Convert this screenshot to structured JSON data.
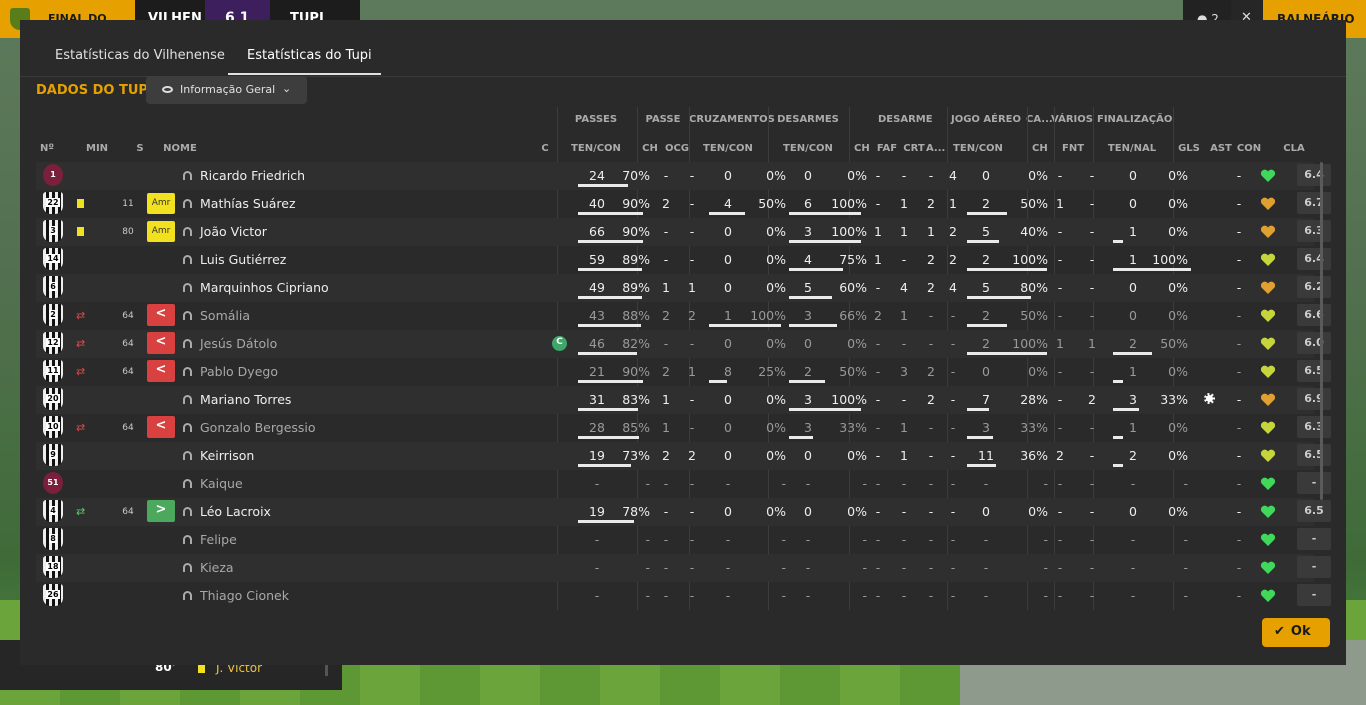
{
  "topbar": {
    "status": "FINAL DO JOGO",
    "home": "VILHEN",
    "away": "TUPI",
    "score": "6   1",
    "people_count": "2",
    "close_glyph": "✕",
    "balneario": "BALNEÁRIO"
  },
  "bg_events": {
    "minute": "80'",
    "player": "J. Victor"
  },
  "tabs": [
    {
      "label": "Estatísticas do Vilhenense",
      "active": false
    },
    {
      "label": "Estatísticas do Tupi",
      "active": true
    }
  ],
  "section_title": "DADOS DO TUPI",
  "dropdown": {
    "label": "Informação Geral"
  },
  "groups": [
    "PASSES",
    "PASSE",
    "CRUZAMENTOS",
    "DESARMES",
    "DESARME",
    "JOGO AÉREO",
    "CA...",
    "VÁRIOS",
    "FINALIZAÇÃO"
  ],
  "headers": [
    "Nº",
    "MIN",
    "S",
    "NOME",
    "C",
    "TEN/CON",
    "CH",
    "OCG",
    "TEN/CON",
    "TEN/CON",
    "CH",
    "FAF",
    "CRT",
    "A...",
    "TEN/CON",
    "CH",
    "FNT",
    "TEN/NAL",
    "GLS",
    "AST",
    "CON",
    "CLA"
  ],
  "players": [
    {
      "n": "1",
      "gk": true,
      "card": false,
      "min": "",
      "badge": "",
      "name": "Ricardo Friedrich",
      "dim": false,
      "cap": false,
      "pt": "24",
      "pp": "70%",
      "pch": "-",
      "pocg": "-",
      "ct": "0",
      "cp": "0%",
      "dt": "0",
      "dp": "0%",
      "dch": "-",
      "dfaf": "-",
      "dcrt": "-",
      "da": "4",
      "at": "0",
      "ap": "0%",
      "cach": "-",
      "fnt": "-",
      "ft": "0",
      "fp": "0%",
      "gls": "",
      "ast": "-",
      "con": "green",
      "cla": "6.4"
    },
    {
      "n": "22",
      "gk": false,
      "card": true,
      "min": "11",
      "badge": "Amr",
      "name": "Mathías Suárez",
      "dim": false,
      "cap": false,
      "pt": "40",
      "pp": "90%",
      "pch": "2",
      "pocg": "-",
      "ct": "4",
      "cp": "50%",
      "dt": "6",
      "dp": "100%",
      "dch": "-",
      "dfaf": "1",
      "dcrt": "2",
      "da": "1",
      "at": "2",
      "ap": "50%",
      "cach": "1",
      "fnt": "-",
      "ft": "0",
      "fp": "0%",
      "gls": "",
      "ast": "-",
      "con": "orange",
      "cla": "6.7"
    },
    {
      "n": "3",
      "gk": false,
      "card": true,
      "min": "80",
      "badge": "Amr",
      "name": "João Victor",
      "dim": false,
      "cap": false,
      "pt": "66",
      "pp": "90%",
      "pch": "-",
      "pocg": "-",
      "ct": "0",
      "cp": "0%",
      "dt": "3",
      "dp": "100%",
      "dch": "1",
      "dfaf": "1",
      "dcrt": "1",
      "da": "2",
      "at": "5",
      "ap": "40%",
      "cach": "-",
      "fnt": "-",
      "ft": "1",
      "fp": "0%",
      "gls": "",
      "ast": "-",
      "con": "orange",
      "cla": "6.3"
    },
    {
      "n": "14",
      "gk": false,
      "card": false,
      "min": "",
      "badge": "",
      "name": "Luis Gutiérrez",
      "dim": false,
      "cap": false,
      "pt": "59",
      "pp": "89%",
      "pch": "-",
      "pocg": "-",
      "ct": "0",
      "cp": "0%",
      "dt": "4",
      "dp": "75%",
      "dch": "1",
      "dfaf": "-",
      "dcrt": "2",
      "da": "2",
      "at": "2",
      "ap": "100%",
      "cach": "-",
      "fnt": "-",
      "ft": "1",
      "fp": "100%",
      "gls": "",
      "ast": "-",
      "con": "yellow",
      "cla": "6.4"
    },
    {
      "n": "6",
      "gk": false,
      "card": false,
      "min": "",
      "badge": "",
      "name": "Marquinhos Cipriano",
      "dim": false,
      "cap": false,
      "pt": "49",
      "pp": "89%",
      "pch": "1",
      "pocg": "1",
      "ct": "0",
      "cp": "0%",
      "dt": "5",
      "dp": "60%",
      "dch": "-",
      "dfaf": "4",
      "dcrt": "2",
      "da": "4",
      "at": "5",
      "ap": "80%",
      "cach": "-",
      "fnt": "-",
      "ft": "0",
      "fp": "0%",
      "gls": "",
      "ast": "-",
      "con": "orange",
      "cla": "6.2"
    },
    {
      "n": "2",
      "gk": false,
      "card": false,
      "min": "64",
      "badge": "out",
      "name": "Somália",
      "dim": true,
      "cap": false,
      "pt": "43",
      "pp": "88%",
      "pch": "2",
      "pocg": "2",
      "ct": "1",
      "cp": "100%",
      "dt": "3",
      "dp": "66%",
      "dch": "2",
      "dfaf": "1",
      "dcrt": "-",
      "da": "-",
      "at": "2",
      "ap": "50%",
      "cach": "-",
      "fnt": "-",
      "ft": "0",
      "fp": "0%",
      "gls": "",
      "ast": "-",
      "con": "yellow",
      "cla": "6.6"
    },
    {
      "n": "12",
      "gk": false,
      "card": false,
      "min": "64",
      "badge": "out",
      "name": "Jesús Dátolo",
      "dim": true,
      "cap": true,
      "pt": "46",
      "pp": "82%",
      "pch": "-",
      "pocg": "-",
      "ct": "0",
      "cp": "0%",
      "dt": "0",
      "dp": "0%",
      "dch": "-",
      "dfaf": "-",
      "dcrt": "-",
      "da": "-",
      "at": "2",
      "ap": "100%",
      "cach": "1",
      "fnt": "1",
      "ft": "2",
      "fp": "50%",
      "gls": "",
      "ast": "-",
      "con": "yellow",
      "cla": "6.0"
    },
    {
      "n": "11",
      "gk": false,
      "card": false,
      "min": "64",
      "badge": "out",
      "name": "Pablo Dyego",
      "dim": true,
      "cap": false,
      "pt": "21",
      "pp": "90%",
      "pch": "2",
      "pocg": "1",
      "ct": "8",
      "cp": "25%",
      "dt": "2",
      "dp": "50%",
      "dch": "-",
      "dfaf": "3",
      "dcrt": "2",
      "da": "-",
      "at": "0",
      "ap": "0%",
      "cach": "-",
      "fnt": "-",
      "ft": "1",
      "fp": "0%",
      "gls": "",
      "ast": "-",
      "con": "yellow",
      "cla": "6.5"
    },
    {
      "n": "20",
      "gk": false,
      "card": false,
      "min": "",
      "badge": "",
      "name": "Mariano Torres",
      "dim": false,
      "cap": false,
      "pt": "31",
      "pp": "83%",
      "pch": "1",
      "pocg": "-",
      "ct": "0",
      "cp": "0%",
      "dt": "3",
      "dp": "100%",
      "dch": "-",
      "dfaf": "-",
      "dcrt": "2",
      "da": "-",
      "at": "7",
      "ap": "28%",
      "cach": "-",
      "fnt": "2",
      "ft": "3",
      "fp": "33%",
      "gls": "ball",
      "ast": "-",
      "con": "orange",
      "cla": "6.9"
    },
    {
      "n": "10",
      "gk": false,
      "card": false,
      "min": "64",
      "badge": "out",
      "name": "Gonzalo Bergessio",
      "dim": true,
      "cap": false,
      "pt": "28",
      "pp": "85%",
      "pch": "1",
      "pocg": "-",
      "ct": "0",
      "cp": "0%",
      "dt": "3",
      "dp": "33%",
      "dch": "-",
      "dfaf": "1",
      "dcrt": "-",
      "da": "-",
      "at": "3",
      "ap": "33%",
      "cach": "-",
      "fnt": "-",
      "ft": "1",
      "fp": "0%",
      "gls": "",
      "ast": "-",
      "con": "yellow",
      "cla": "6.3"
    },
    {
      "n": "9",
      "gk": false,
      "card": false,
      "min": "",
      "badge": "",
      "name": "Keirrison",
      "dim": false,
      "cap": false,
      "pt": "19",
      "pp": "73%",
      "pch": "2",
      "pocg": "2",
      "ct": "0",
      "cp": "0%",
      "dt": "0",
      "dp": "0%",
      "dch": "-",
      "dfaf": "1",
      "dcrt": "-",
      "da": "-",
      "at": "11",
      "ap": "36%",
      "cach": "2",
      "fnt": "-",
      "ft": "2",
      "fp": "0%",
      "gls": "",
      "ast": "-",
      "con": "yellow",
      "cla": "6.5"
    },
    {
      "n": "51",
      "gk": true,
      "card": false,
      "min": "",
      "badge": "",
      "name": "Kaique",
      "dim": true,
      "cap": false,
      "pt": "-",
      "pp": "-",
      "pch": "-",
      "pocg": "-",
      "ct": "-",
      "cp": "-",
      "dt": "-",
      "dp": "-",
      "dch": "-",
      "dfaf": "-",
      "dcrt": "-",
      "da": "-",
      "at": "-",
      "ap": "-",
      "cach": "-",
      "fnt": "-",
      "ft": "-",
      "fp": "-",
      "gls": "",
      "ast": "-",
      "con": "green",
      "cla": "-"
    },
    {
      "n": "4",
      "gk": false,
      "card": false,
      "min": "64",
      "badge": "in",
      "name": "Léo Lacroix",
      "dim": false,
      "cap": false,
      "pt": "19",
      "pp": "78%",
      "pch": "-",
      "pocg": "-",
      "ct": "0",
      "cp": "0%",
      "dt": "0",
      "dp": "0%",
      "dch": "-",
      "dfaf": "-",
      "dcrt": "-",
      "da": "-",
      "at": "0",
      "ap": "0%",
      "cach": "-",
      "fnt": "-",
      "ft": "0",
      "fp": "0%",
      "gls": "",
      "ast": "-",
      "con": "green",
      "cla": "6.5"
    },
    {
      "n": "8",
      "gk": false,
      "card": false,
      "min": "",
      "badge": "",
      "name": "Felipe",
      "dim": true,
      "cap": false,
      "pt": "-",
      "pp": "-",
      "pch": "-",
      "pocg": "-",
      "ct": "-",
      "cp": "-",
      "dt": "-",
      "dp": "-",
      "dch": "-",
      "dfaf": "-",
      "dcrt": "-",
      "da": "-",
      "at": "-",
      "ap": "-",
      "cach": "-",
      "fnt": "-",
      "ft": "-",
      "fp": "-",
      "gls": "",
      "ast": "-",
      "con": "green",
      "cla": "-"
    },
    {
      "n": "18",
      "gk": false,
      "card": false,
      "min": "",
      "badge": "",
      "name": "Kieza",
      "dim": true,
      "cap": false,
      "pt": "-",
      "pp": "-",
      "pch": "-",
      "pocg": "-",
      "ct": "-",
      "cp": "-",
      "dt": "-",
      "dp": "-",
      "dch": "-",
      "dfaf": "-",
      "dcrt": "-",
      "da": "-",
      "at": "-",
      "ap": "-",
      "cach": "-",
      "fnt": "-",
      "ft": "-",
      "fp": "-",
      "gls": "",
      "ast": "-",
      "con": "green",
      "cla": "-"
    },
    {
      "n": "26",
      "gk": false,
      "card": false,
      "min": "",
      "badge": "",
      "name": "Thiago Cionek",
      "dim": true,
      "cap": false,
      "pt": "-",
      "pp": "-",
      "pch": "-",
      "pocg": "-",
      "ct": "-",
      "cp": "-",
      "dt": "-",
      "dp": "-",
      "dch": "-",
      "dfaf": "-",
      "dcrt": "-",
      "da": "-",
      "at": "-",
      "ap": "-",
      "cach": "-",
      "fnt": "-",
      "ft": "-",
      "fp": "-",
      "gls": "",
      "ast": "-",
      "con": "green",
      "cla": "-"
    }
  ],
  "captain_letter": "C",
  "sub_out_glyph": "<",
  "sub_in_glyph": ">",
  "ok_label": "Ok",
  "colors": {
    "accent": "#e6a100",
    "sub_out": "#d94040",
    "sub_in": "#4ca85c",
    "con_green": "#3fd85a",
    "con_yellow": "#c6d63a",
    "con_orange": "#e0a030",
    "yellow_card": "#f2e11e"
  }
}
